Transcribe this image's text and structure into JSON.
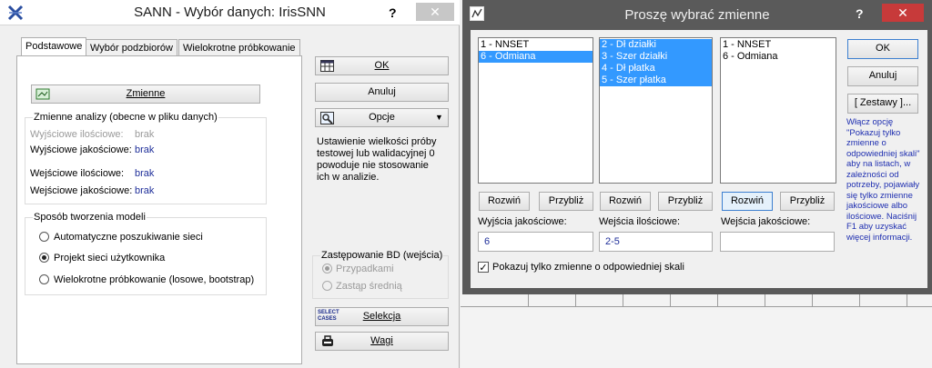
{
  "left_window": {
    "title": "SANN - Wybór danych: IrisSNN",
    "help": "?",
    "close": "✕",
    "tabs": [
      "Podstawowe",
      "Wybór podzbiorów",
      "Wielokrotne próbkowanie"
    ],
    "variables_button": "Zmienne",
    "analysis_group_title": "Zmienne analizy (obecne w pliku danych)",
    "rows": [
      {
        "label": "Wyjściowe ilościowe:",
        "value": "brak"
      },
      {
        "label": "Wyjściowe jakościowe:",
        "value": "brak"
      },
      {
        "label": "Wejściowe ilościowe:",
        "value": "brak"
      },
      {
        "label": "Wejściowe jakościowe:",
        "value": "brak"
      }
    ],
    "model_group_title": "Sposób tworzenia modeli",
    "model_options": [
      "Automatyczne poszukiwanie sieci",
      "Projekt sieci użytkownika",
      "Wielokrotne próbkowanie (losowe, bootstrap)"
    ],
    "ok_button": "OK",
    "cancel_button": "Anuluj",
    "options_button": "Opcje",
    "info_text": "Ustawienie wielkości próby testowej lub walidacyjnej 0 powoduje nie stosowanie ich w analizie.",
    "replace_group_title": "Zastępowanie BD (wejścia)",
    "replace_options": [
      "Przypadkami",
      "Zastąp średnią"
    ],
    "select_cases_icon_line1": "SELECT",
    "select_cases_icon_line2": "CASES",
    "selection_button": "Selekcja",
    "weights_button": "Wagi"
  },
  "right_window": {
    "title": "Proszę wybrać zmienne",
    "help": "?",
    "close": "✕",
    "list1": [
      "1 - NNSET",
      "6 - Odmiana"
    ],
    "list2": [
      "2 - Dł działki",
      "3 - Szer działki",
      "4 - Dł płatka",
      "5 - Szer płatka"
    ],
    "list3": [
      "1 - NNSET",
      "6 - Odmiana"
    ],
    "expand_label": "Rozwiń",
    "zoom_label": "Przybliż",
    "field1_label": "Wyjścia jakościowe:",
    "field2_label": "Wejścia ilościowe:",
    "field3_label": "Wejścia jakościowe:",
    "field1_value": "6",
    "field2_value": "2-5",
    "field3_value": "",
    "checkbox_label": "Pokazuj tylko zmienne o odpowiedniej skali",
    "checkbox_mark": "✓",
    "ok_button": "OK",
    "cancel_button": "Anuluj",
    "sets_button": "[ Zestawy ]...",
    "note_text": "Włącz opcję \"Pokazuj tylko zmienne o odpowiedniej skali\" aby na listach, w zależności od potrzeby, pojawiały się tylko zmienne jakościowe albo ilościowe. Naciśnij F1 aby uzyskać więcej informacji."
  },
  "colors": {
    "selection": "#3399ff",
    "value_blue": "#1f2f9a",
    "dark_frame": "#5a5a5a"
  }
}
